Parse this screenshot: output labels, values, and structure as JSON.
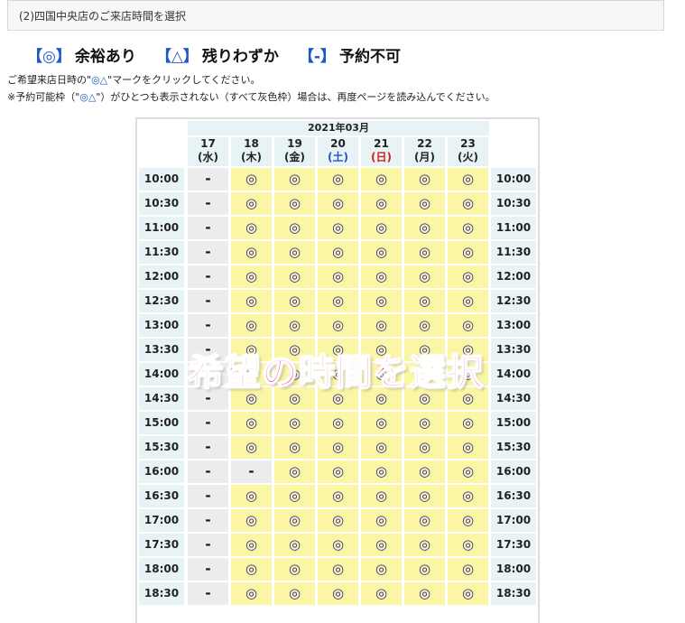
{
  "header": {
    "title": "(2)四国中央店のご来店時間を選択"
  },
  "legend": [
    {
      "symbol": "【◎】",
      "label": "余裕あり"
    },
    {
      "symbol": "【△】",
      "label": "残りわずか"
    },
    {
      "symbol": "【-】",
      "label": "予約不可"
    }
  ],
  "help": {
    "line1_prefix": "ご希望来店日時の\"",
    "line1_symbols": "◎△",
    "line1_suffix": "\"マークをクリックしてください。",
    "line2_prefix": "※予約可能枠（\"",
    "line2_symbols": "◎△",
    "line2_suffix": "\"）がひとつも表示されない（すべて灰色枠）場合は、再度ページを読み込んでください。"
  },
  "calendar": {
    "month": "2021年03月",
    "days": [
      {
        "date": "17",
        "dow": "(水)",
        "type": "weekday"
      },
      {
        "date": "18",
        "dow": "(木)",
        "type": "weekday"
      },
      {
        "date": "19",
        "dow": "(金)",
        "type": "weekday"
      },
      {
        "date": "20",
        "dow": "(土)",
        "type": "sat"
      },
      {
        "date": "21",
        "dow": "(日)",
        "type": "sun"
      },
      {
        "date": "22",
        "dow": "(月)",
        "type": "weekday"
      },
      {
        "date": "23",
        "dow": "(火)",
        "type": "weekday"
      }
    ],
    "rows": [
      {
        "time": "10:00",
        "slots": [
          "-",
          "◎",
          "◎",
          "◎",
          "◎",
          "◎",
          "◎"
        ]
      },
      {
        "time": "10:30",
        "slots": [
          "-",
          "◎",
          "◎",
          "◎",
          "◎",
          "◎",
          "◎"
        ]
      },
      {
        "time": "11:00",
        "slots": [
          "-",
          "◎",
          "◎",
          "◎",
          "◎",
          "◎",
          "◎"
        ]
      },
      {
        "time": "11:30",
        "slots": [
          "-",
          "◎",
          "◎",
          "◎",
          "◎",
          "◎",
          "◎"
        ]
      },
      {
        "time": "12:00",
        "slots": [
          "-",
          "◎",
          "◎",
          "◎",
          "◎",
          "◎",
          "◎"
        ]
      },
      {
        "time": "12:30",
        "slots": [
          "-",
          "◎",
          "◎",
          "◎",
          "◎",
          "◎",
          "◎"
        ]
      },
      {
        "time": "13:00",
        "slots": [
          "-",
          "◎",
          "◎",
          "◎",
          "◎",
          "◎",
          "◎"
        ]
      },
      {
        "time": "13:30",
        "slots": [
          "-",
          "◎",
          "◎",
          "◎",
          "◎",
          "◎",
          "◎"
        ]
      },
      {
        "time": "14:00",
        "slots": [
          "-",
          "◎",
          "◎",
          "◎",
          "◎",
          "◎",
          "◎"
        ]
      },
      {
        "time": "14:30",
        "slots": [
          "-",
          "◎",
          "◎",
          "◎",
          "◎",
          "◎",
          "◎"
        ]
      },
      {
        "time": "15:00",
        "slots": [
          "-",
          "◎",
          "◎",
          "◎",
          "◎",
          "◎",
          "◎"
        ]
      },
      {
        "time": "15:30",
        "slots": [
          "-",
          "◎",
          "◎",
          "◎",
          "◎",
          "◎",
          "◎"
        ]
      },
      {
        "time": "16:00",
        "slots": [
          "-",
          "-",
          "◎",
          "◎",
          "◎",
          "◎",
          "◎"
        ]
      },
      {
        "time": "16:30",
        "slots": [
          "-",
          "◎",
          "◎",
          "◎",
          "◎",
          "◎",
          "◎"
        ]
      },
      {
        "time": "17:00",
        "slots": [
          "-",
          "◎",
          "◎",
          "◎",
          "◎",
          "◎",
          "◎"
        ]
      },
      {
        "time": "17:30",
        "slots": [
          "-",
          "◎",
          "◎",
          "◎",
          "◎",
          "◎",
          "◎"
        ]
      },
      {
        "time": "18:00",
        "slots": [
          "-",
          "◎",
          "◎",
          "◎",
          "◎",
          "◎",
          "◎"
        ]
      },
      {
        "time": "18:30",
        "slots": [
          "-",
          "◎",
          "◎",
          "◎",
          "◎",
          "◎",
          "◎"
        ]
      }
    ]
  },
  "overlay": {
    "text": "希望の時間を選択"
  },
  "colors": {
    "available": "#fbf6a3",
    "unavailable": "#ececec",
    "header_cell": "#e8f3f5",
    "accent_blue": "#1f57c7",
    "sunday_red": "#d32020",
    "overlay_pink": "#ff3d8b"
  }
}
